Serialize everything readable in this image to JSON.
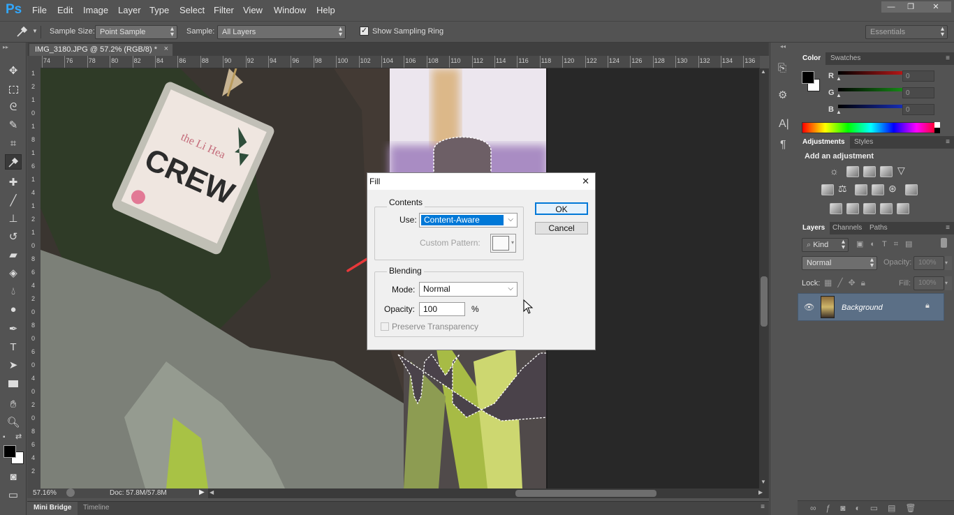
{
  "app": {
    "logo": "Ps"
  },
  "menus": [
    "File",
    "Edit",
    "Image",
    "Layer",
    "Type",
    "Select",
    "Filter",
    "View",
    "Window",
    "Help"
  ],
  "window_controls": {
    "minimize": "—",
    "restore": "❐",
    "close": "✕"
  },
  "options_bar": {
    "sample_size_label": "Sample Size:",
    "sample_size_value": "Point Sample",
    "sample_label": "Sample:",
    "sample_value": "All Layers",
    "show_ring_label": "Show Sampling Ring",
    "show_ring_checked": true,
    "workspace": "Essentials"
  },
  "document": {
    "tab_title": "IMG_3180.JPG @ 57.2% (RGB/8) *",
    "close": "×",
    "ruler_ticks": [
      "74",
      "76",
      "78",
      "80",
      "82",
      "84",
      "86",
      "88",
      "90",
      "92",
      "94",
      "96",
      "98",
      "100",
      "102",
      "104",
      "106",
      "108",
      "110",
      "112",
      "114",
      "116",
      "118",
      "120",
      "122",
      "124",
      "126",
      "128",
      "130",
      "132",
      "134",
      "136"
    ],
    "ruler_left": [
      "1",
      "2",
      "1",
      "0",
      "1",
      "8",
      "1",
      "6",
      "1",
      "4",
      "1",
      "2",
      "1",
      "0",
      "8",
      "6",
      "4",
      "2",
      "0",
      "8",
      "0",
      "6",
      "0",
      "4",
      "0",
      "2",
      "0",
      "8",
      "6",
      "4",
      "2"
    ],
    "badge_text_1": "the Li Hea",
    "badge_text_2": "CREW"
  },
  "status": {
    "zoom": "57.16%",
    "doc": "Doc: 57.8M/57.8M"
  },
  "bottom_tabs": [
    "Mini Bridge",
    "Timeline"
  ],
  "tools": [
    "move",
    "marquee",
    "lasso",
    "quick-select",
    "crop",
    "eyedropper",
    "healing",
    "brush",
    "stamp",
    "history-brush",
    "eraser",
    "gradient",
    "blur",
    "dodge",
    "pen",
    "type",
    "path-select",
    "shape",
    "hand",
    "zoom"
  ],
  "panels": {
    "color": {
      "tabs": [
        "Color",
        "Swatches"
      ],
      "channels": [
        {
          "name": "R",
          "value": "0",
          "color": "#ff2020"
        },
        {
          "name": "G",
          "value": "0",
          "color": "#20c020"
        },
        {
          "name": "B",
          "value": "0",
          "color": "#2040ff"
        }
      ]
    },
    "adjustments": {
      "tabs": [
        "Adjustments",
        "Styles"
      ],
      "heading": "Add an adjustment"
    },
    "layers": {
      "tabs": [
        "Layers",
        "Channels",
        "Paths"
      ],
      "kind": "Kind",
      "blend": "Normal",
      "opacity_label": "Opacity:",
      "opacity": "100%",
      "lock_label": "Lock:",
      "fill_label": "Fill:",
      "fill": "100%",
      "layer_name": "Background"
    }
  },
  "fill_dialog": {
    "title": "Fill",
    "close": "✕",
    "contents_label": "Contents",
    "use_label": "Use:",
    "use_value": "Content-Aware",
    "custom_pattern_label": "Custom Pattern:",
    "blending_label": "Blending",
    "mode_label": "Mode:",
    "mode_value": "Normal",
    "opacity_label": "Opacity:",
    "opacity_value": "100",
    "percent": "%",
    "preserve_label": "Preserve Transparency",
    "ok": "OK",
    "cancel": "Cancel"
  }
}
